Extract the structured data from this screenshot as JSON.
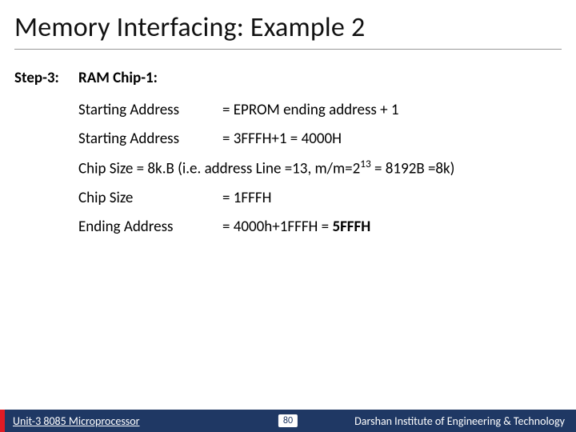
{
  "title": "Memory Interfacing: Example 2",
  "step": {
    "label": "Step-3:",
    "heading": "RAM Chip-1:"
  },
  "rows": {
    "r1": {
      "left": "Starting Address",
      "right": "= EPROM ending address + 1"
    },
    "r2": {
      "left": "Starting Address",
      "right": "= 3FFFH+1 = 4000H"
    },
    "r3": {
      "full_a": "Chip Size = 8k.B (i.e. address Line =13, m/m=2",
      "sup": "13",
      "full_b": " = 8192B =8k)"
    },
    "r4": {
      "left": "Chip Size",
      "right": "= 1FFFH"
    },
    "r5": {
      "left": "Ending Address",
      "right_a": "= 4000h+1FFFH = ",
      "right_b": "5FFFH"
    }
  },
  "footer": {
    "unit": "Unit-3 8085 Microprocessor",
    "page": "80",
    "inst": "Darshan Institute of Engineering & Technology"
  }
}
